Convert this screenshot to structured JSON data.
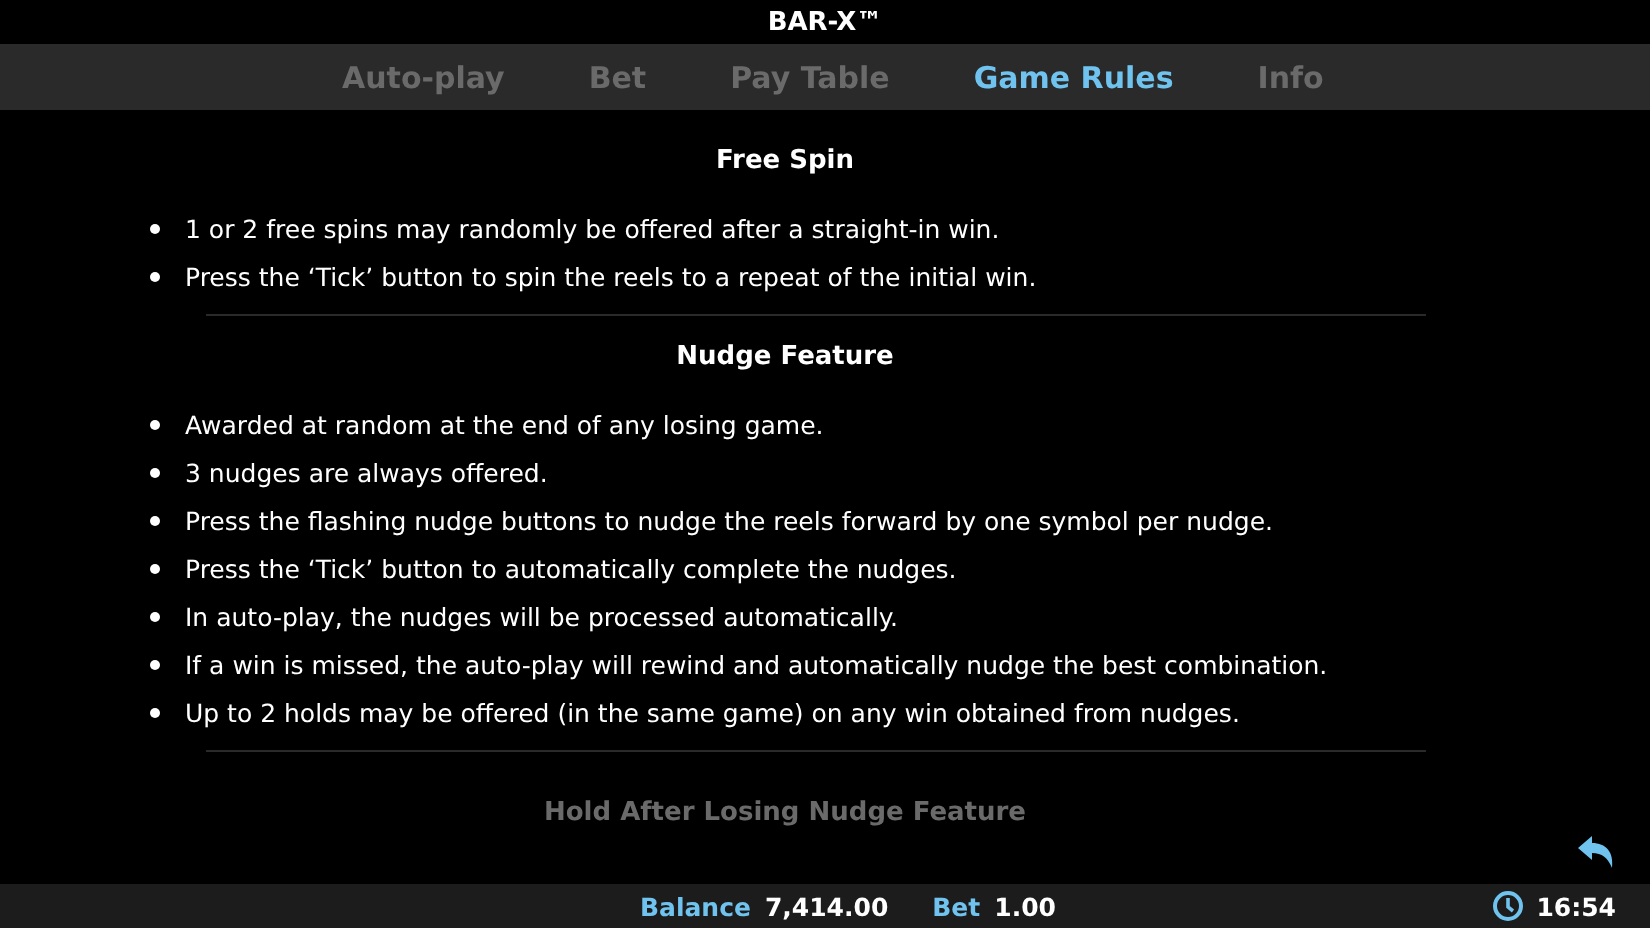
{
  "window": {
    "title": "BAR-X™"
  },
  "tabs": [
    {
      "label": "Auto-play",
      "selected": false
    },
    {
      "label": "Bet",
      "selected": false
    },
    {
      "label": "Pay Table",
      "selected": false
    },
    {
      "label": "Game Rules",
      "selected": true
    },
    {
      "label": "Info",
      "selected": false
    }
  ],
  "sections": [
    {
      "heading": "Free Spin",
      "faded": false,
      "bullets": [
        "1 or 2 free spins may randomly be offered after a straight-in win.",
        "Press the ‘Tick’ button to spin the reels to a repeat of the initial win."
      ]
    },
    {
      "heading": "Nudge Feature",
      "faded": false,
      "bullets": [
        "Awarded at random at the end of any losing game.",
        "3 nudges are always offered.",
        "Press the flashing nudge buttons to nudge the reels forward by one symbol per nudge.",
        "Press the ‘Tick’ button to automatically complete the nudges.",
        "In auto-play, the nudges will be processed automatically.",
        "If a win is missed, the auto-play will rewind and automatically nudge the best combination.",
        "Up to 2 holds may be offered (in the same game) on any win obtained from nudges."
      ]
    },
    {
      "heading": "Hold After Losing Nudge Feature",
      "faded": true
    }
  ],
  "status_bar": {
    "balance_label": "Balance",
    "balance": "7,414.00",
    "bet_label": "Bet",
    "bet": "1.00",
    "time": "16:54"
  }
}
